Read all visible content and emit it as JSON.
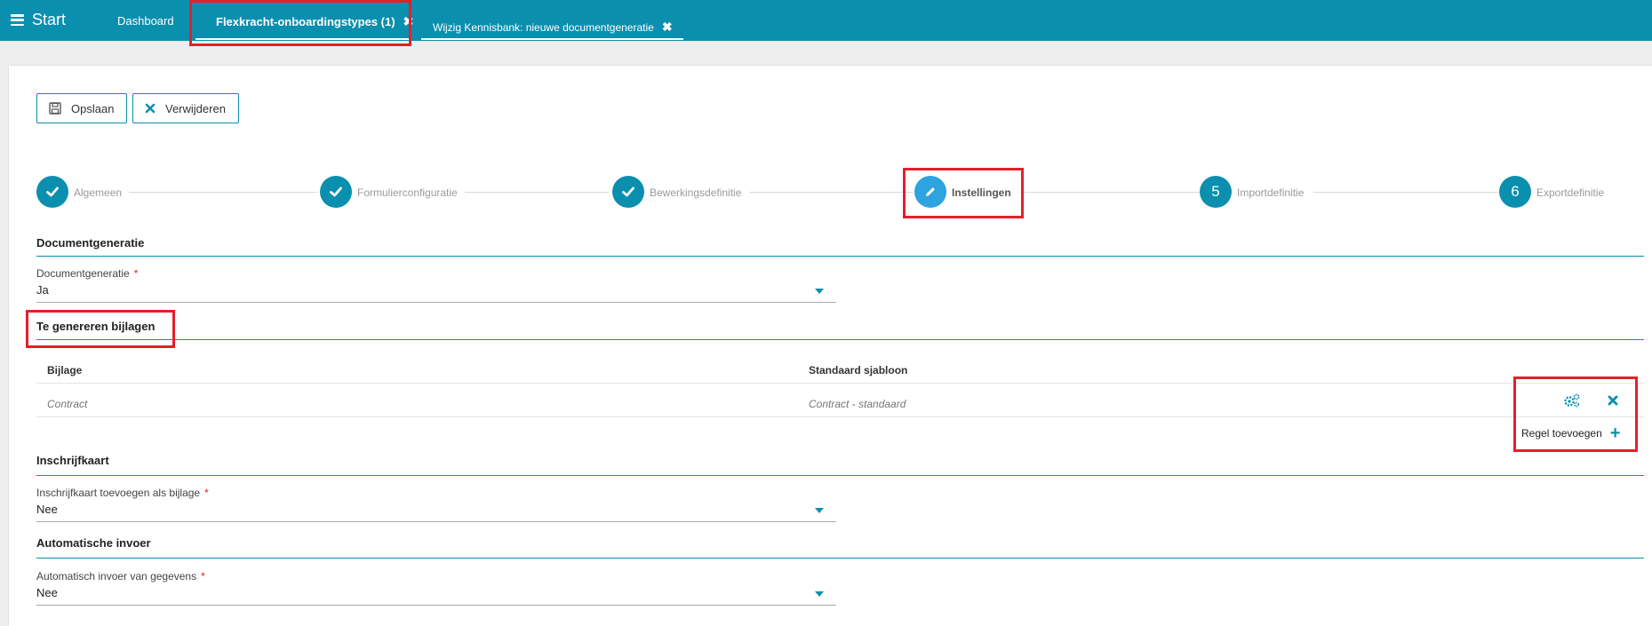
{
  "topbar": {
    "start_label": "Start",
    "tabs": [
      {
        "label": "Dashboard"
      },
      {
        "label": "Flexkracht-onboardingstypes (1)",
        "close": "✖"
      },
      {
        "label": "Wijzig Kennisbank: nieuwe documentgeneratie",
        "close": "✖"
      }
    ]
  },
  "toolbar": {
    "save_label": "Opslaan",
    "delete_label": "Verwijderen"
  },
  "steps": [
    {
      "label": "Algemeen",
      "state": "done",
      "icon": "check-icon"
    },
    {
      "label": "Formulierconfiguratie",
      "state": "done",
      "icon": "check-icon"
    },
    {
      "label": "Bewerkingsdefinitie",
      "state": "done",
      "icon": "check-icon"
    },
    {
      "label": "Instellingen",
      "state": "active",
      "icon": "pencil-icon"
    },
    {
      "label": "Importdefinitie",
      "state": "todo",
      "number": "5"
    },
    {
      "label": "Exportdefinitie",
      "state": "todo",
      "number": "6"
    }
  ],
  "sections": {
    "documentgeneratie": {
      "title": "Documentgeneratie",
      "field_label": "Documentgeneratie",
      "required_mark": "*",
      "value": "Ja"
    },
    "bijlagen": {
      "title": "Te genereren bijlagen",
      "columns": [
        "Bijlage",
        "Standaard sjabloon"
      ],
      "rows": [
        {
          "bijlage": "Contract",
          "sjabloon": "Contract - standaard"
        }
      ],
      "add_row_label": "Regel toevoegen",
      "add_icon": "+"
    },
    "inschrijfkaart": {
      "title": "Inschrijfkaart",
      "field_label": "Inschrijfkaart toevoegen als bijlage",
      "required_mark": "*",
      "value": "Nee"
    },
    "automatische_invoer": {
      "title": "Automatische invoer",
      "field_label": "Automatisch invoer van gegevens",
      "required_mark": "*",
      "value": "Nee"
    }
  },
  "colors": {
    "brand": "#0b8fae",
    "active_step": "#2da3e0",
    "annotation": "#e3202a"
  }
}
